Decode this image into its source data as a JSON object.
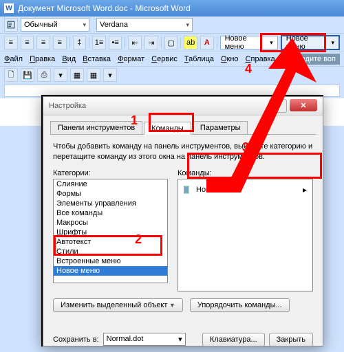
{
  "window_title": "Документ Microsoft Word.doc - Microsoft Word",
  "style_name": "Обычный",
  "font_name": "Verdana",
  "new_menu_label": "Новое меню",
  "menubar": {
    "file": "Файл",
    "edit": "Правка",
    "view": "Вид",
    "insert": "Вставка",
    "format": "Формат",
    "service": "Сервис",
    "table": "Таблица",
    "window": "Окно",
    "help": "Справка"
  },
  "type_question": "Введите воп",
  "dialog": {
    "title": "Настройка",
    "tabs": {
      "toolbars": "Панели инструментов",
      "commands": "Команды",
      "params": "Параметры"
    },
    "instruction": "Чтобы добавить команду на панель инструментов, выберите категорию и перетащите команду из этого окна на панель инструментов.",
    "categories_label": "Категории:",
    "commands_label": "Команды:",
    "categories": [
      "Слияние",
      "Формы",
      "Элементы управления",
      "Все команды",
      "Макросы",
      "Шрифты",
      "Автотекст",
      "Стили",
      "Встроенные меню",
      "Новое меню"
    ],
    "command_item": "Новое меню",
    "change_obj": "Изменить выделенный объект",
    "reorder": "Упорядочить команды...",
    "save_in_label": "Сохранить в:",
    "save_in_value": "Normal.dot",
    "keyboard": "Клавиатура...",
    "close": "Закрыть"
  },
  "anno": {
    "n1": "1",
    "n2": "2",
    "n3": "3",
    "n4": "4"
  },
  "chart_data": null
}
